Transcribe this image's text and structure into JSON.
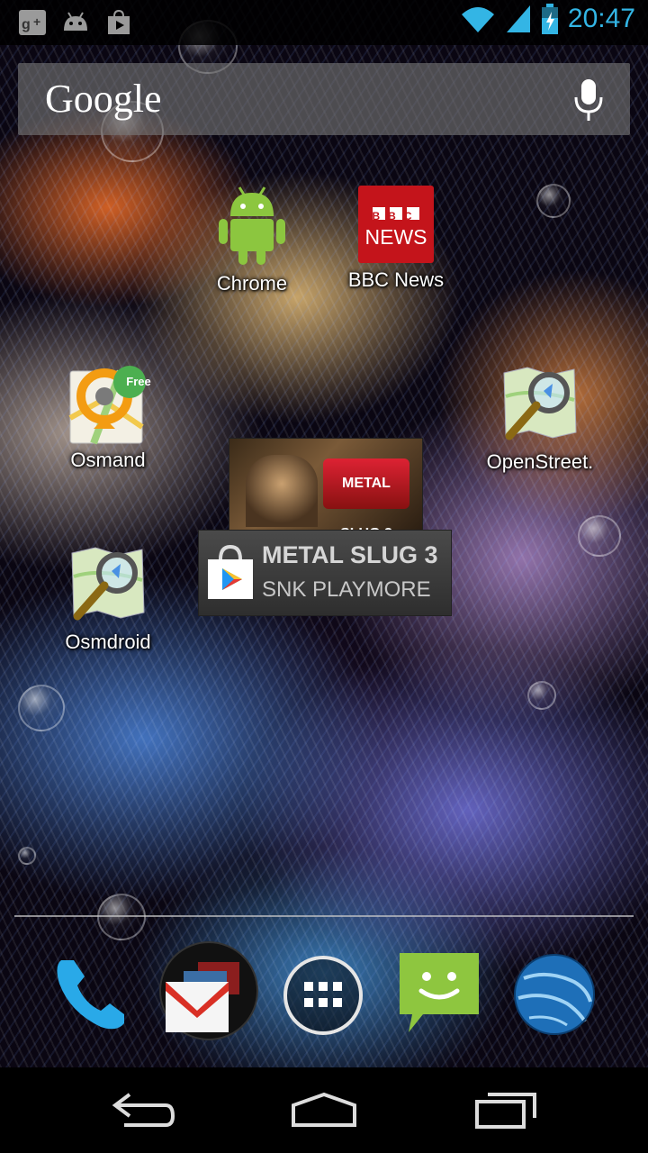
{
  "status_bar": {
    "time": "20:47",
    "left_icons": [
      "google-plus-icon",
      "android-debug-icon",
      "play-store-notification-icon"
    ],
    "right_icons": [
      "wifi-icon",
      "cell-signal-icon",
      "battery-charging-icon"
    ],
    "accent_color": "#33b5e5"
  },
  "search": {
    "logo_text": "Google",
    "voice_icon": "microphone-icon"
  },
  "apps": [
    {
      "label": "Chrome",
      "icon": "android-robot-icon"
    },
    {
      "label": "BBC News",
      "icon": "bbc-news-icon",
      "icon_text_top": "BBC",
      "icon_text_bottom": "NEWS"
    },
    {
      "label": "Osmand",
      "icon": "osmand-icon",
      "badge": "Free"
    },
    {
      "label": "OpenStreet.",
      "icon": "openstreetmap-icon"
    },
    {
      "label": "Osmdroid",
      "icon": "osmdroid-icon"
    }
  ],
  "widget": {
    "title": "METAL SLUG 3",
    "subtitle": "SNK PLAYMORE",
    "art_text": "METAL SLUG 3",
    "icon": "play-store-bag-icon"
  },
  "dock": [
    "phone-icon",
    "gmail-folder-icon",
    "app-drawer-icon",
    "messaging-icon",
    "earth-icon"
  ],
  "navigation": [
    "back-icon",
    "home-icon",
    "recent-apps-icon"
  ]
}
